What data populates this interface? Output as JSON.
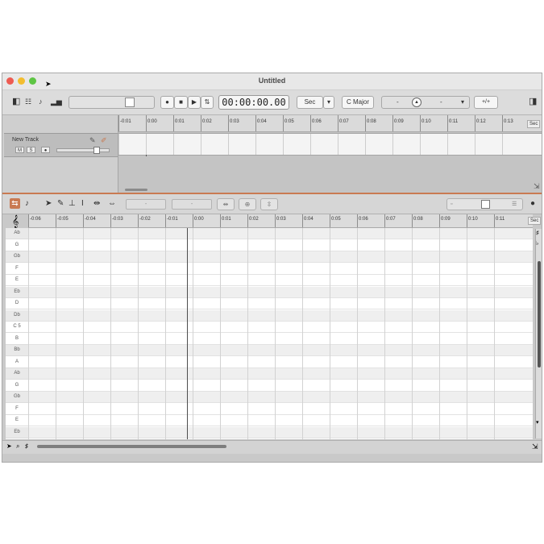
{
  "window": {
    "title": "Untitled"
  },
  "toolbar": {
    "time_display": "00:00:00.00",
    "time_format": "Sec",
    "key_signature": "C Major",
    "tempo_left": "-",
    "tempo_right": "-"
  },
  "tracks": [
    {
      "name": "New Track",
      "mute_label": "M",
      "solo_label": "S",
      "record_label": "●"
    }
  ],
  "ruler_top": {
    "ticks": [
      "-0:01",
      "0:00",
      "0:01",
      "0:02",
      "0:03",
      "0:04",
      "0:05",
      "0:06",
      "0:07",
      "0:08",
      "0:09",
      "0:10",
      "0:11",
      "0:12",
      "0:13"
    ],
    "unit": "Sec"
  },
  "editor": {
    "ruler_ticks": [
      "-0:06",
      "-0:05",
      "-0:04",
      "-0:03",
      "-0:02",
      "-0:01",
      "0:00",
      "0:01",
      "0:02",
      "0:03",
      "0:04",
      "0:05",
      "0:06",
      "0:07",
      "0:08",
      "0:09",
      "0:10",
      "0:11"
    ],
    "unit": "Sec",
    "field_left": "-",
    "field_right": "-",
    "keys": [
      {
        "label": "Ab",
        "black": true
      },
      {
        "label": "G",
        "black": false
      },
      {
        "label": "Gb",
        "black": true
      },
      {
        "label": "F",
        "black": false
      },
      {
        "label": "E",
        "black": false
      },
      {
        "label": "Eb",
        "black": true
      },
      {
        "label": "D",
        "black": false
      },
      {
        "label": "Db",
        "black": true
      },
      {
        "label": "C 5",
        "black": false
      },
      {
        "label": "B",
        "black": false
      },
      {
        "label": "Bb",
        "black": true
      },
      {
        "label": "A",
        "black": false
      },
      {
        "label": "Ab",
        "black": true
      },
      {
        "label": "G",
        "black": false
      },
      {
        "label": "Gb",
        "black": true
      },
      {
        "label": "F",
        "black": false
      },
      {
        "label": "E",
        "black": false
      },
      {
        "label": "Eb",
        "black": true
      }
    ]
  },
  "colors": {
    "accent": "#c97a52",
    "record": "#d94a3a"
  }
}
